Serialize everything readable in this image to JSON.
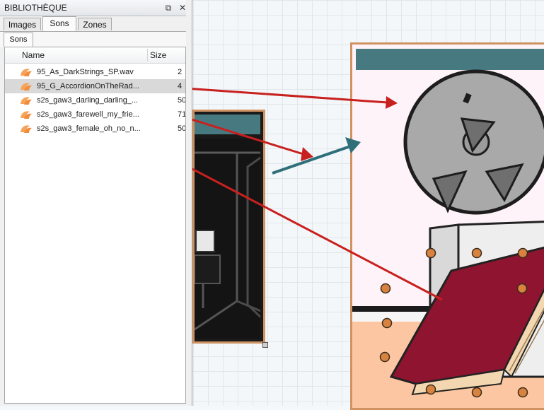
{
  "panel": {
    "title": "BIBLIOTHÈQUE",
    "dock_glyph": "⧉",
    "close_glyph": "✕",
    "tabs": [
      {
        "label": "Images"
      },
      {
        "label": "Sons"
      },
      {
        "label": "Zones"
      }
    ],
    "active_tab": "Sons",
    "subtab": {
      "label": "Sons"
    },
    "columns": {
      "name": "Name",
      "size": "Size"
    },
    "items": [
      {
        "name": "95_As_DarkStrings_SP.wav",
        "size": "2"
      },
      {
        "name": "95_G_AccordionOnTheRad...",
        "size": "4"
      },
      {
        "name": "s2s_gaw3_darling_darling_...",
        "size": "50"
      },
      {
        "name": "s2s_gaw3_farewell_my_frie...",
        "size": "71"
      },
      {
        "name": "s2s_gaw3_female_oh_no_n...",
        "size": "50"
      }
    ],
    "selected_index": 1
  },
  "colors": {
    "arrow_red": "#c8201e",
    "arrow_teal": "#2f6f7a",
    "frame_border": "#cf9363",
    "title_band": "#477a80",
    "book_red": "#8e1430",
    "dot_orange": "#d7823f"
  }
}
